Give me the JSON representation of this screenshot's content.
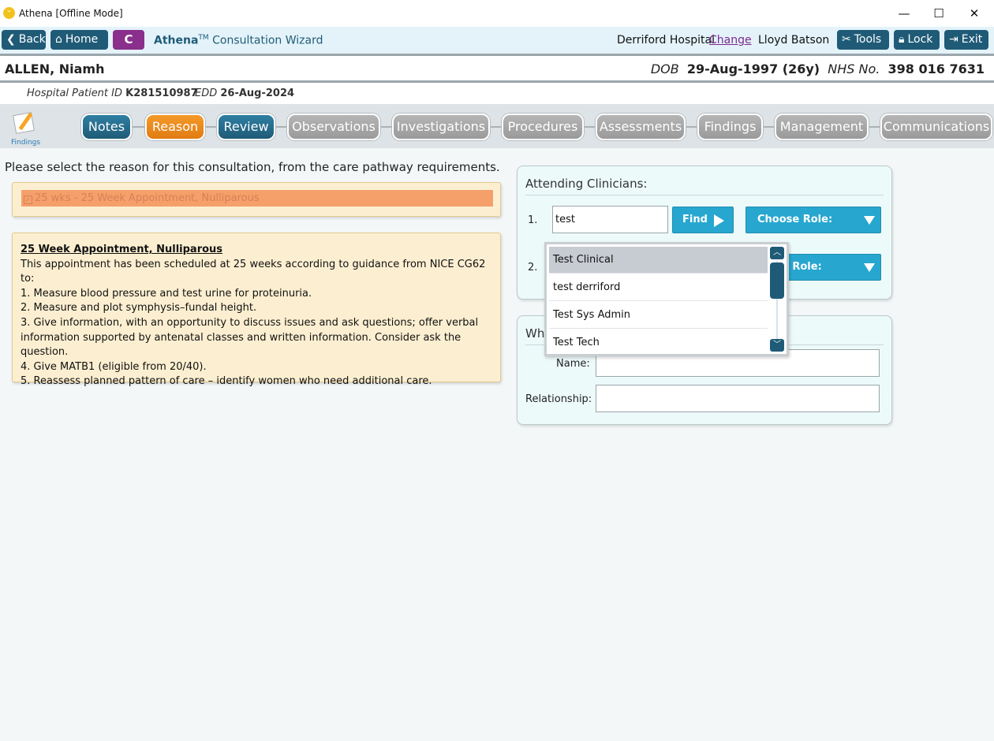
{
  "window": {
    "title": "Athena [Offline Mode]",
    "minimize": "—",
    "maximize": "☐",
    "close": "✕"
  },
  "toolbar": {
    "back_label": "Back",
    "home_label": "Home",
    "c_label": "C",
    "app_brand": "Athena",
    "app_tm": "TM",
    "app_title": " Consultation Wizard",
    "hospital": "Derriford Hospital",
    "change_label": "Change",
    "user": "Lloyd Batson",
    "tools_label": "Tools",
    "lock_label": "Lock",
    "exit_label": "Exit"
  },
  "patient": {
    "name": "ALLEN, Niamh",
    "dob_label": "DOB",
    "dob": "29-Aug-1997 (26y)",
    "nhs_label": "NHS No.",
    "nhs": "398 016 7631",
    "hospital_id_label": "Hospital Patient ID",
    "hospital_id": "K281510987",
    "edd_label": "EDD",
    "edd": "26-Aug-2024"
  },
  "wizard": {
    "icon_caption": "Findings",
    "tabs": [
      {
        "label": "Notes",
        "state": "blue"
      },
      {
        "label": "Reason",
        "state": "orange"
      },
      {
        "label": "Review",
        "state": "blue"
      },
      {
        "label": "Observations",
        "state": "grey"
      },
      {
        "label": "Investigations",
        "state": "grey"
      },
      {
        "label": "Procedures",
        "state": "grey"
      },
      {
        "label": "Assessments",
        "state": "grey"
      },
      {
        "label": "Findings",
        "state": "grey"
      },
      {
        "label": "Management",
        "state": "grey"
      },
      {
        "label": "Communications",
        "state": "grey"
      }
    ]
  },
  "main": {
    "prompt": "Please select the reason for this consultation, from the care pathway requirements.",
    "reason_item": "25 wks - 25 Week Appointment, Nulliparous",
    "info_title": "25 Week Appointment, Nulliparous",
    "info_lines": [
      "This appointment has been scheduled at 25 weeks according to guidance from NICE CG62 to:",
      "1. Measure blood pressure and test urine for proteinuria.",
      "2. Measure and plot symphysis–fundal height.",
      "3. Give information, with an opportunity to discuss issues and ask questions; offer verbal information supported by antenatal classes and written information. Consider ask the question.",
      "4. Give MATB1 (eligible from 20/40).",
      "5. Reassess planned pattern of care – identify women who need additional care."
    ]
  },
  "clinicians": {
    "title": "Attending Clinicians:",
    "row1_num": "1.",
    "row1_value": "test",
    "find_label": "Find",
    "role_placeholder": "Choose Role:",
    "row2_num": "2.",
    "row2_role_visible": "e Role:"
  },
  "witness": {
    "title_visible": "Wh",
    "name_label": "Name:",
    "name_value": "",
    "relationship_label": "Relationship:",
    "relationship_value": ""
  },
  "dropdown": {
    "items": [
      "Test Clinical",
      "test derriford",
      "Test Sys Admin",
      "Test Tech"
    ],
    "selected": "Test Clinical"
  },
  "colors": {
    "accent_dark": "#1f5b77",
    "accent_cyan": "#27a7cf",
    "reason_orange": "#f59f6b",
    "c_purple": "#8a2f8c"
  }
}
